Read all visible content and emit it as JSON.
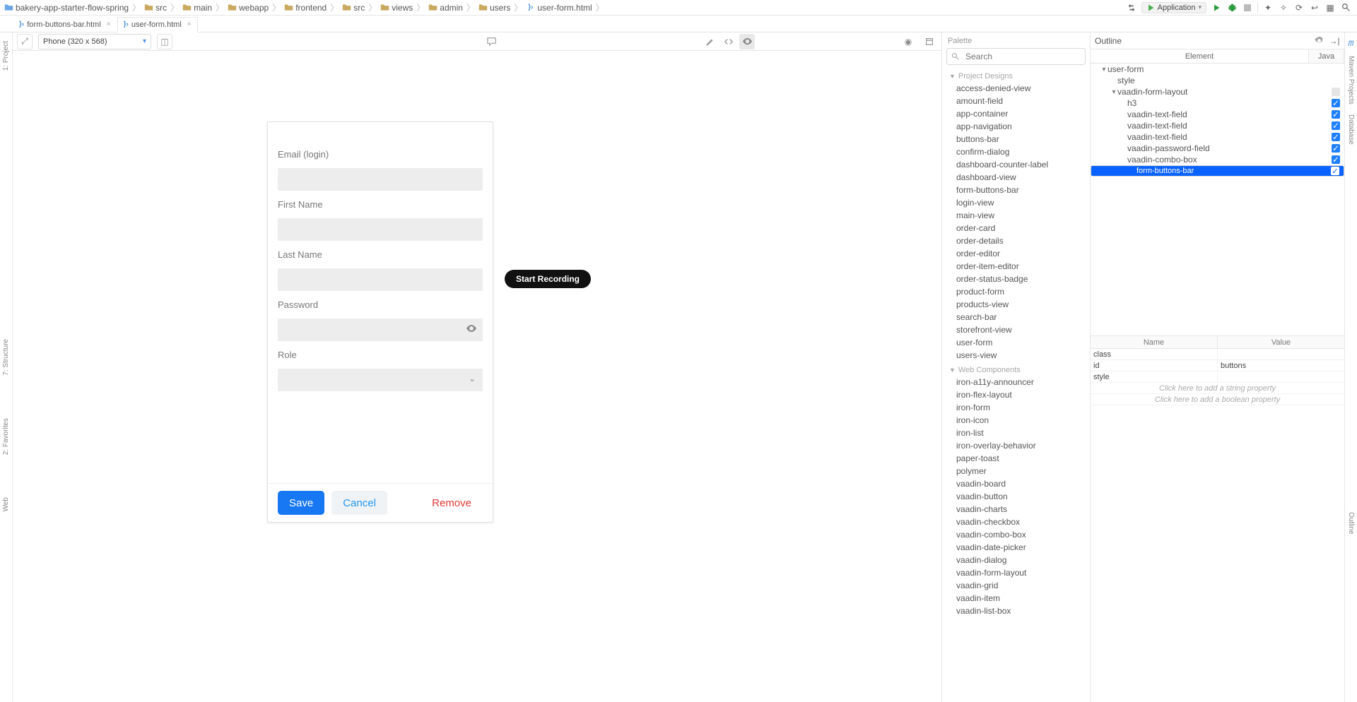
{
  "breadcrumbs": [
    {
      "icon": "folder-blue",
      "label": "bakery-app-starter-flow-spring"
    },
    {
      "icon": "folder",
      "label": "src"
    },
    {
      "icon": "folder",
      "label": "main"
    },
    {
      "icon": "folder",
      "label": "webapp"
    },
    {
      "icon": "folder",
      "label": "frontend"
    },
    {
      "icon": "folder",
      "label": "src"
    },
    {
      "icon": "folder",
      "label": "views"
    },
    {
      "icon": "folder",
      "label": "admin"
    },
    {
      "icon": "folder",
      "label": "users"
    },
    {
      "icon": "file-html",
      "label": "user-form.html"
    }
  ],
  "run_config": {
    "label": "Application"
  },
  "editor_tabs": [
    {
      "label": "form-buttons-bar.html",
      "active": false
    },
    {
      "label": "user-form.html",
      "active": true
    }
  ],
  "device_selector": "Phone (320 x 568)",
  "recording_label": "Start Recording",
  "form": {
    "fields": [
      {
        "label": "Email (login)",
        "type": "text"
      },
      {
        "label": "First Name",
        "type": "text"
      },
      {
        "label": "Last Name",
        "type": "text"
      },
      {
        "label": "Password",
        "type": "password"
      },
      {
        "label": "Role",
        "type": "combo"
      }
    ],
    "actions": {
      "save": "Save",
      "cancel": "Cancel",
      "remove": "Remove"
    }
  },
  "palette": {
    "title": "Palette",
    "search_placeholder": "Search",
    "groups": [
      {
        "name": "Project Designs",
        "items": [
          "access-denied-view",
          "amount-field",
          "app-container",
          "app-navigation",
          "buttons-bar",
          "confirm-dialog",
          "dashboard-counter-label",
          "dashboard-view",
          "form-buttons-bar",
          "login-view",
          "main-view",
          "order-card",
          "order-details",
          "order-editor",
          "order-item-editor",
          "order-status-badge",
          "product-form",
          "products-view",
          "search-bar",
          "storefront-view",
          "user-form",
          "users-view"
        ]
      },
      {
        "name": "Web Components",
        "items": [
          "iron-a11y-announcer",
          "iron-flex-layout",
          "iron-form",
          "iron-icon",
          "iron-list",
          "iron-overlay-behavior",
          "paper-toast",
          "polymer",
          "vaadin-board",
          "vaadin-button",
          "vaadin-charts",
          "vaadin-checkbox",
          "vaadin-combo-box",
          "vaadin-date-picker",
          "vaadin-dialog",
          "vaadin-form-layout",
          "vaadin-grid",
          "vaadin-item",
          "vaadin-list-box"
        ]
      }
    ]
  },
  "outline": {
    "title": "Outline",
    "tabs": {
      "element": "Element",
      "java": "Java"
    },
    "tree": [
      {
        "depth": 0,
        "label": "user-form",
        "caret": "down",
        "check": null,
        "sel": false
      },
      {
        "depth": 1,
        "label": "style",
        "caret": "",
        "check": null,
        "sel": false
      },
      {
        "depth": 1,
        "label": "vaadin-form-layout",
        "caret": "down",
        "check": "off",
        "sel": false
      },
      {
        "depth": 2,
        "label": "h3",
        "caret": "",
        "check": "on",
        "sel": false
      },
      {
        "depth": 2,
        "label": "vaadin-text-field",
        "caret": "",
        "check": "on",
        "sel": false
      },
      {
        "depth": 2,
        "label": "vaadin-text-field",
        "caret": "",
        "check": "on",
        "sel": false
      },
      {
        "depth": 2,
        "label": "vaadin-text-field",
        "caret": "",
        "check": "on",
        "sel": false
      },
      {
        "depth": 2,
        "label": "vaadin-password-field",
        "caret": "",
        "check": "on",
        "sel": false
      },
      {
        "depth": 2,
        "label": "vaadin-combo-box",
        "caret": "",
        "check": "on",
        "sel": false
      },
      {
        "depth": 2,
        "label": "form-buttons-bar",
        "caret": "",
        "check": "on",
        "sel": true
      }
    ],
    "props_header": {
      "name": "Name",
      "value": "Value"
    },
    "props": [
      {
        "name": "class",
        "value": ""
      },
      {
        "name": "id",
        "value": "buttons"
      },
      {
        "name": "style",
        "value": ""
      }
    ],
    "hints": {
      "string": "Click here to add a string property",
      "boolean": "Click here to add a boolean property"
    }
  },
  "left_gutter": [
    {
      "label": "1: Project"
    },
    {
      "label": "7: Structure"
    },
    {
      "label": "2: Favorites"
    },
    {
      "label": "Web"
    }
  ],
  "right_gutter": [
    {
      "label": "Maven Projects",
      "marker": "m"
    },
    {
      "label": "Database"
    },
    {
      "label": "Outline"
    }
  ]
}
